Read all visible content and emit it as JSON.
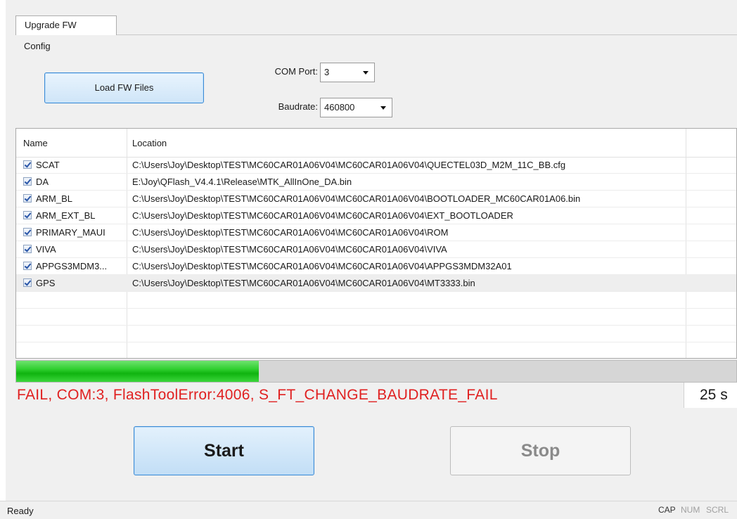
{
  "tab": {
    "label": "Upgrade FW"
  },
  "config": {
    "label": "Config",
    "load_button": "Load FW Files",
    "com_port_label": "COM Port:",
    "com_port_value": "3",
    "baudrate_label": "Baudrate:",
    "baudrate_value": "460800"
  },
  "table": {
    "columns": [
      "Name",
      "Location"
    ],
    "rows": [
      {
        "checked": true,
        "name": "SCAT",
        "location": "C:\\Users\\Joy\\Desktop\\TEST\\MC60CAR01A06V04\\MC60CAR01A06V04\\QUECTEL03D_M2M_11C_BB.cfg"
      },
      {
        "checked": true,
        "name": "DA",
        "location": "E:\\Joy\\QFlash_V4.4.1\\Release\\MTK_AllInOne_DA.bin"
      },
      {
        "checked": true,
        "name": "ARM_BL",
        "location": "C:\\Users\\Joy\\Desktop\\TEST\\MC60CAR01A06V04\\MC60CAR01A06V04\\BOOTLOADER_MC60CAR01A06.bin"
      },
      {
        "checked": true,
        "name": "ARM_EXT_BL",
        "location": "C:\\Users\\Joy\\Desktop\\TEST\\MC60CAR01A06V04\\MC60CAR01A06V04\\EXT_BOOTLOADER"
      },
      {
        "checked": true,
        "name": "PRIMARY_MAUI",
        "location": "C:\\Users\\Joy\\Desktop\\TEST\\MC60CAR01A06V04\\MC60CAR01A06V04\\ROM"
      },
      {
        "checked": true,
        "name": "VIVA",
        "location": "C:\\Users\\Joy\\Desktop\\TEST\\MC60CAR01A06V04\\MC60CAR01A06V04\\VIVA"
      },
      {
        "checked": true,
        "name": "APPGS3MDM3...",
        "location": "C:\\Users\\Joy\\Desktop\\TEST\\MC60CAR01A06V04\\MC60CAR01A06V04\\APPGS3MDM32A01"
      },
      {
        "checked": true,
        "name": "GPS",
        "location": "C:\\Users\\Joy\\Desktop\\TEST\\MC60CAR01A06V04\\MC60CAR01A06V04\\MT3333.bin"
      }
    ]
  },
  "progress": {
    "fraction": 0.337,
    "status_message": "FAIL, COM:3, FlashToolError:4006, S_FT_CHANGE_BAUDRATE_FAIL",
    "elapsed": "25 s"
  },
  "buttons": {
    "start": "Start",
    "stop": "Stop"
  },
  "statusbar": {
    "text": "Ready",
    "indicators": [
      "CAP",
      "NUM",
      "SCRL"
    ]
  },
  "colors": {
    "error_text": "#e02020",
    "progress_green": "#22c422",
    "button_border": "#3c8ad4"
  }
}
